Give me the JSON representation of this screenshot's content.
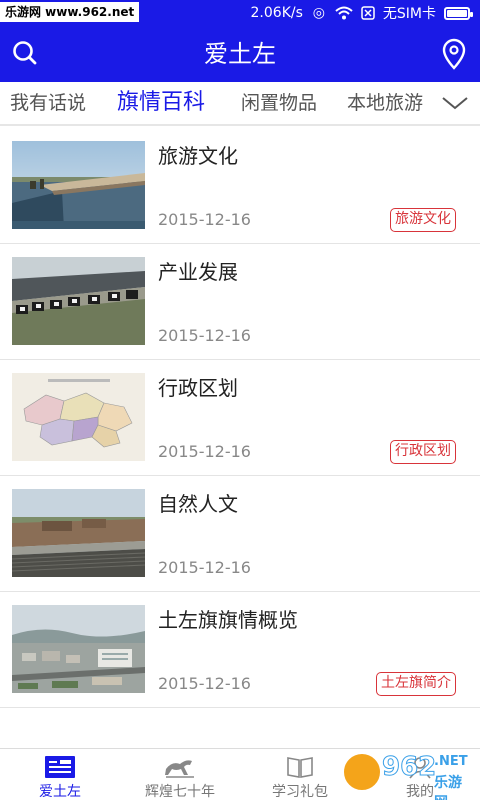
{
  "status_bar": {
    "watermark": "乐游网 www.962.net",
    "speed": "2.06K/s",
    "sim": "无SIM卡",
    "battery_level": 0.9
  },
  "app_bar": {
    "title": "爱土左"
  },
  "tabs": [
    {
      "label": "我有话说",
      "active": false
    },
    {
      "label": "旗情百科",
      "active": true
    },
    {
      "label": "闲置物品",
      "active": false
    },
    {
      "label": "本地旅游",
      "active": false
    }
  ],
  "articles": [
    {
      "title": "旅游文化",
      "date": "2015-12-16",
      "tag": "旅游文化",
      "thumb": "lake-boardwalk"
    },
    {
      "title": "产业发展",
      "date": "2015-12-16",
      "tag": "",
      "thumb": "dairy-cows"
    },
    {
      "title": "行政区划",
      "date": "2015-12-16",
      "tag": "行政区划",
      "thumb": "district-map"
    },
    {
      "title": "自然人文",
      "date": "2015-12-16",
      "tag": "",
      "thumb": "old-buildings"
    },
    {
      "title": "土左旗旗情概览",
      "date": "2015-12-16",
      "tag": "土左旗简介",
      "thumb": "city-aerial"
    }
  ],
  "bottom_nav": [
    {
      "label": "爱土左",
      "active": true,
      "icon": "news-icon"
    },
    {
      "label": "辉煌七十年",
      "active": false,
      "icon": "horse-icon"
    },
    {
      "label": "学习礼包",
      "active": false,
      "icon": "book-icon"
    },
    {
      "label": "我的",
      "active": false,
      "icon": "person-icon"
    }
  ],
  "watermark_bottom": {
    "number": "962",
    "net": ".NET",
    "cn": "乐游网"
  },
  "colors": {
    "primary": "#1a1ae6",
    "tag_red": "#d8343a"
  }
}
